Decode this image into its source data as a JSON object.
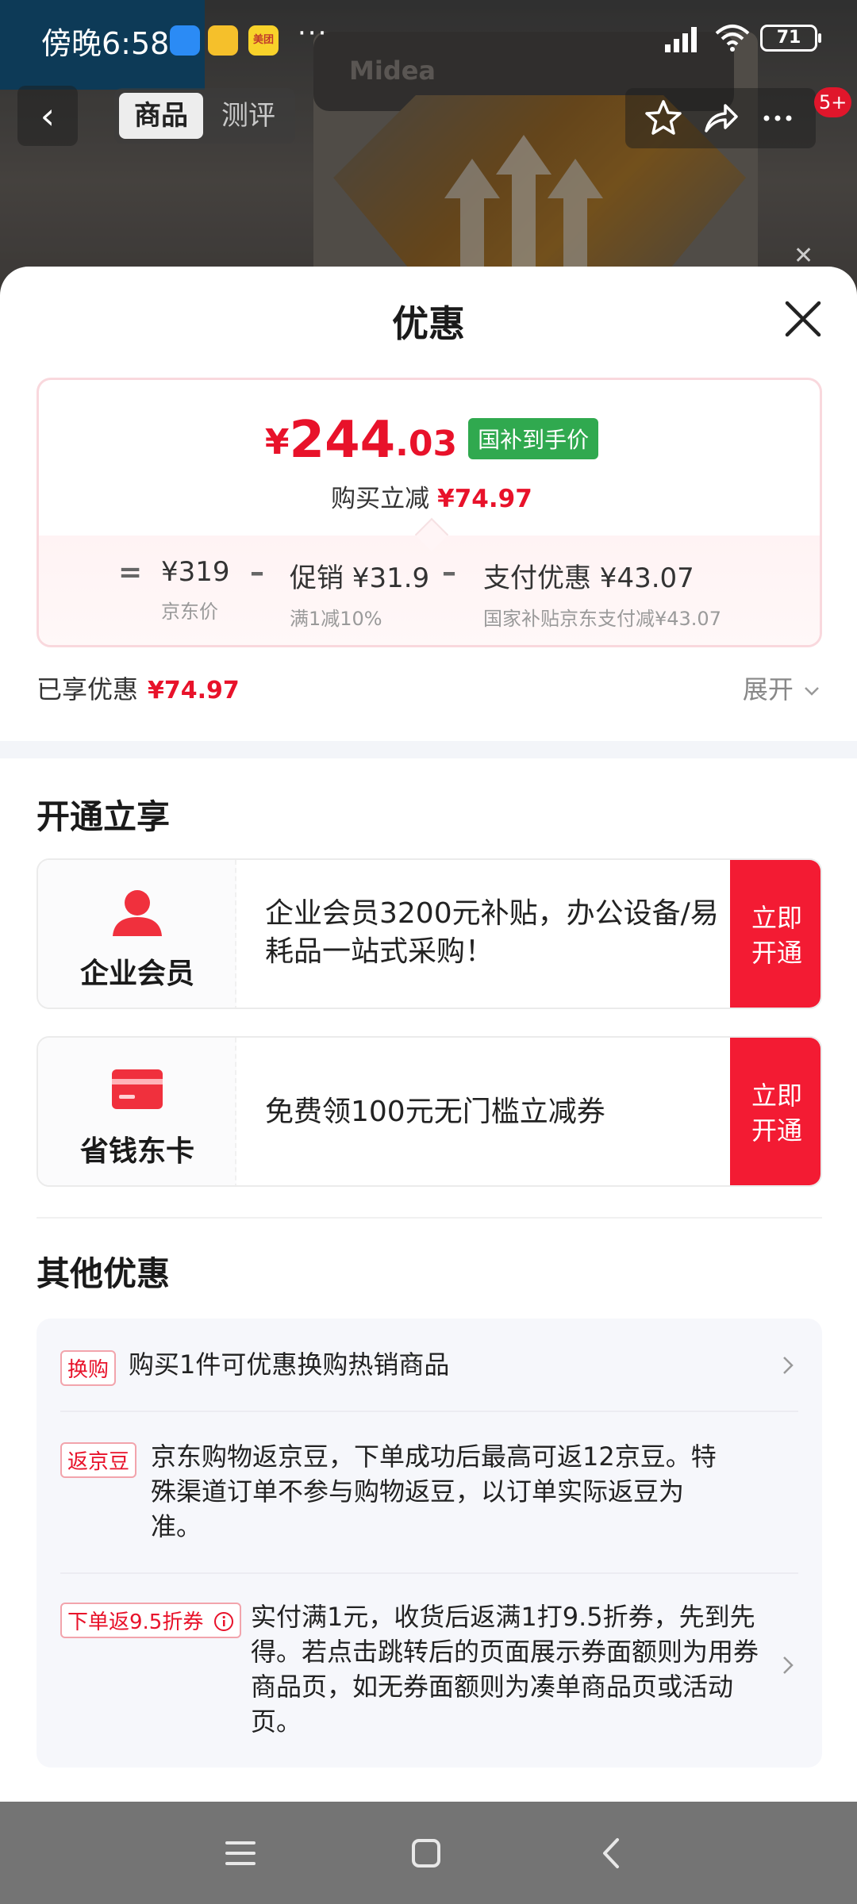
{
  "status_bar": {
    "time": "傍晚6:58",
    "meituan_label": "美团",
    "more": "···",
    "battery": "71"
  },
  "product_nav": {
    "back": "‹",
    "tabs": [
      "商品",
      "测评"
    ],
    "badge": "5+"
  },
  "background": {
    "brand": "Midea"
  },
  "sheet": {
    "title": "优惠",
    "price": {
      "symbol": "¥",
      "integer": "244",
      "decimal": ".03",
      "tag": "国补到手价",
      "sub_label": "购买立减",
      "sub_value": "¥74.97"
    },
    "formula": {
      "eq": "=",
      "minus": "–",
      "jd_price": "¥319",
      "jd_price_label": "京东价",
      "promo": "促销 ¥31.9",
      "promo_label": "满1减10%",
      "pay": "支付优惠 ¥43.07",
      "pay_label": "国家补贴京东支付减¥43.07"
    },
    "enjoyed_label": "已享优惠",
    "enjoyed_value": "¥74.97",
    "expand": "展开"
  },
  "open_section": {
    "title": "开通立享",
    "cards": [
      {
        "name": "企业会员",
        "desc": "企业会员3200元补贴，办公设备/易耗品一站式采购！",
        "button": "立即开通"
      },
      {
        "name": "省钱东卡",
        "desc": "免费领100元无门槛立减券",
        "button": "立即开通"
      }
    ]
  },
  "other_section": {
    "title": "其他优惠",
    "items": [
      {
        "tag": "换购",
        "text": "购买1件可优惠换购热销商品"
      },
      {
        "tag": "返京豆",
        "text": "京东购物返京豆，下单成功后最高可返12京豆。特殊渠道订单不参与购物返豆，以订单实际返豆为准。"
      },
      {
        "tag": "下单返9.5折券",
        "text": "实付满1元，收货后返满1打9.5折券，先到先得。若点击跳转后的页面展示券面额则为用券商品页，如无券面额则为凑单商品页或活动页。"
      }
    ]
  },
  "colors": {
    "accent_red": "#f31b33",
    "price_red": "#e8122a",
    "tag_green": "#30a94f"
  }
}
